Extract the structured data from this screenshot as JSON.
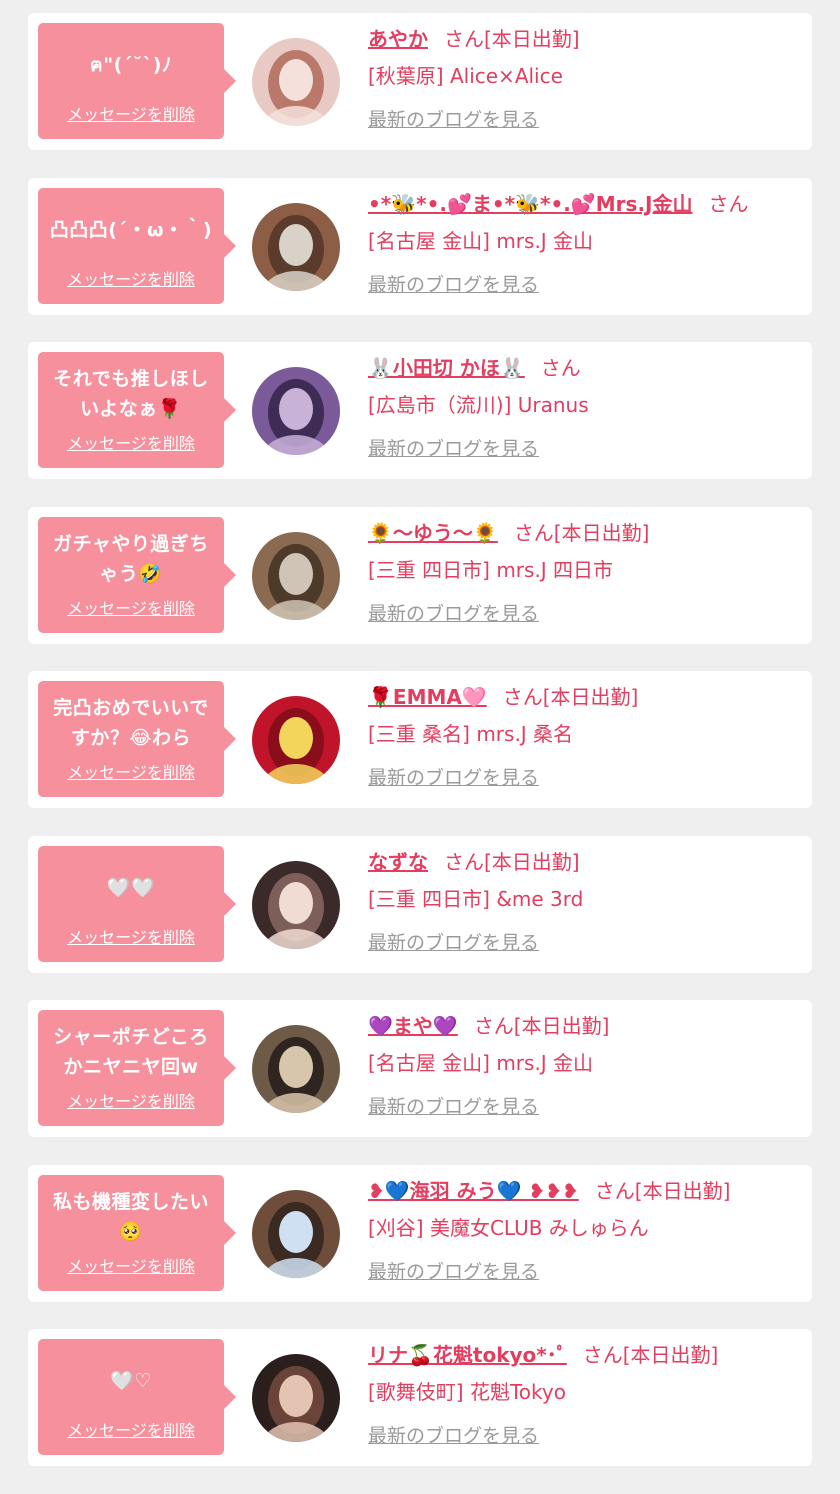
{
  "ui": {
    "delete_label": "メッセージを削除",
    "blog_label": "最新のブログを見る",
    "colors": {
      "background": "#efefef",
      "card": "#ffffff",
      "bubble": "#f7909d",
      "accent_text": "#e33d5f",
      "muted_link": "#9a9a9a"
    }
  },
  "messages": [
    {
      "message": "ฅ\"(ˊ˘ˋ)ﾉ",
      "name": "あやか",
      "suffix": "さん[本日出勤]",
      "shop": "[秋葉原] Alice×Alice",
      "avatar_colors": [
        "#e9c9c4",
        "#f4e1dc",
        "#b9786a"
      ]
    },
    {
      "message": "凸凸凸(´・ω・｀)",
      "name": "•*🐝*•.💕ま•*🐝*•.💕Mrs.J金山",
      "suffix": "さん",
      "shop": "[名古屋 金山] mrs.J 金山",
      "avatar_colors": [
        "#8b5e45",
        "#d9d2c8",
        "#5b3b2b"
      ]
    },
    {
      "message": "それでも推しほしいよなぁ🌹",
      "name": "🐰小田切 かほ🐰",
      "suffix": "さん",
      "shop": "[広島市（流川)] Uranus",
      "avatar_colors": [
        "#7a5a98",
        "#c8b2d8",
        "#3f2c55"
      ]
    },
    {
      "message": "ガチャやり過ぎちゃう🤣",
      "name": "🌻〜ゆう〜🌻",
      "suffix": "さん[本日出勤]",
      "shop": "[三重 四日市] mrs.J 四日市",
      "avatar_colors": [
        "#8a6a50",
        "#cfc4b5",
        "#4d3a2b"
      ]
    },
    {
      "message": "完凸おめでいいですか？😂わら",
      "name": "🌹EMMA🩷",
      "suffix": "さん[本日出勤]",
      "shop": "[三重 桑名] mrs.J 桑名",
      "avatar_colors": [
        "#c0142a",
        "#f2d55a",
        "#8a0d1c"
      ]
    },
    {
      "message": "🤍🤍",
      "name": "なずな",
      "suffix": "さん[本日出勤]",
      "shop": "[三重 四日市] &me 3rd",
      "avatar_colors": [
        "#3a2a2a",
        "#f1dcd3",
        "#7e5e58"
      ]
    },
    {
      "message": "シャーポチどころかニヤニヤ回w",
      "name": "💜まや💜",
      "suffix": "さん[本日出勤]",
      "shop": "[名古屋 金山] mrs.J 金山",
      "avatar_colors": [
        "#6d5a47",
        "#d8c6ac",
        "#2f2520"
      ]
    },
    {
      "message": "私も機種変したい🥺",
      "name": "❥💙海羽 みう💙 ❥❥❥",
      "suffix": "さん[本日出勤]",
      "shop": "[刈谷] 美魔女CLUB みしゅらん",
      "avatar_colors": [
        "#6e4e3b",
        "#cfe0f3",
        "#3a2a22"
      ]
    },
    {
      "message": "🤍♡",
      "name": "リナ🍒花魁tokyo*･ﾟ",
      "suffix": "さん[本日出勤]",
      "shop": "[歌舞伎町] 花魁Tokyo",
      "avatar_colors": [
        "#2a1f1c",
        "#e4c3b2",
        "#6a4438"
      ]
    }
  ]
}
